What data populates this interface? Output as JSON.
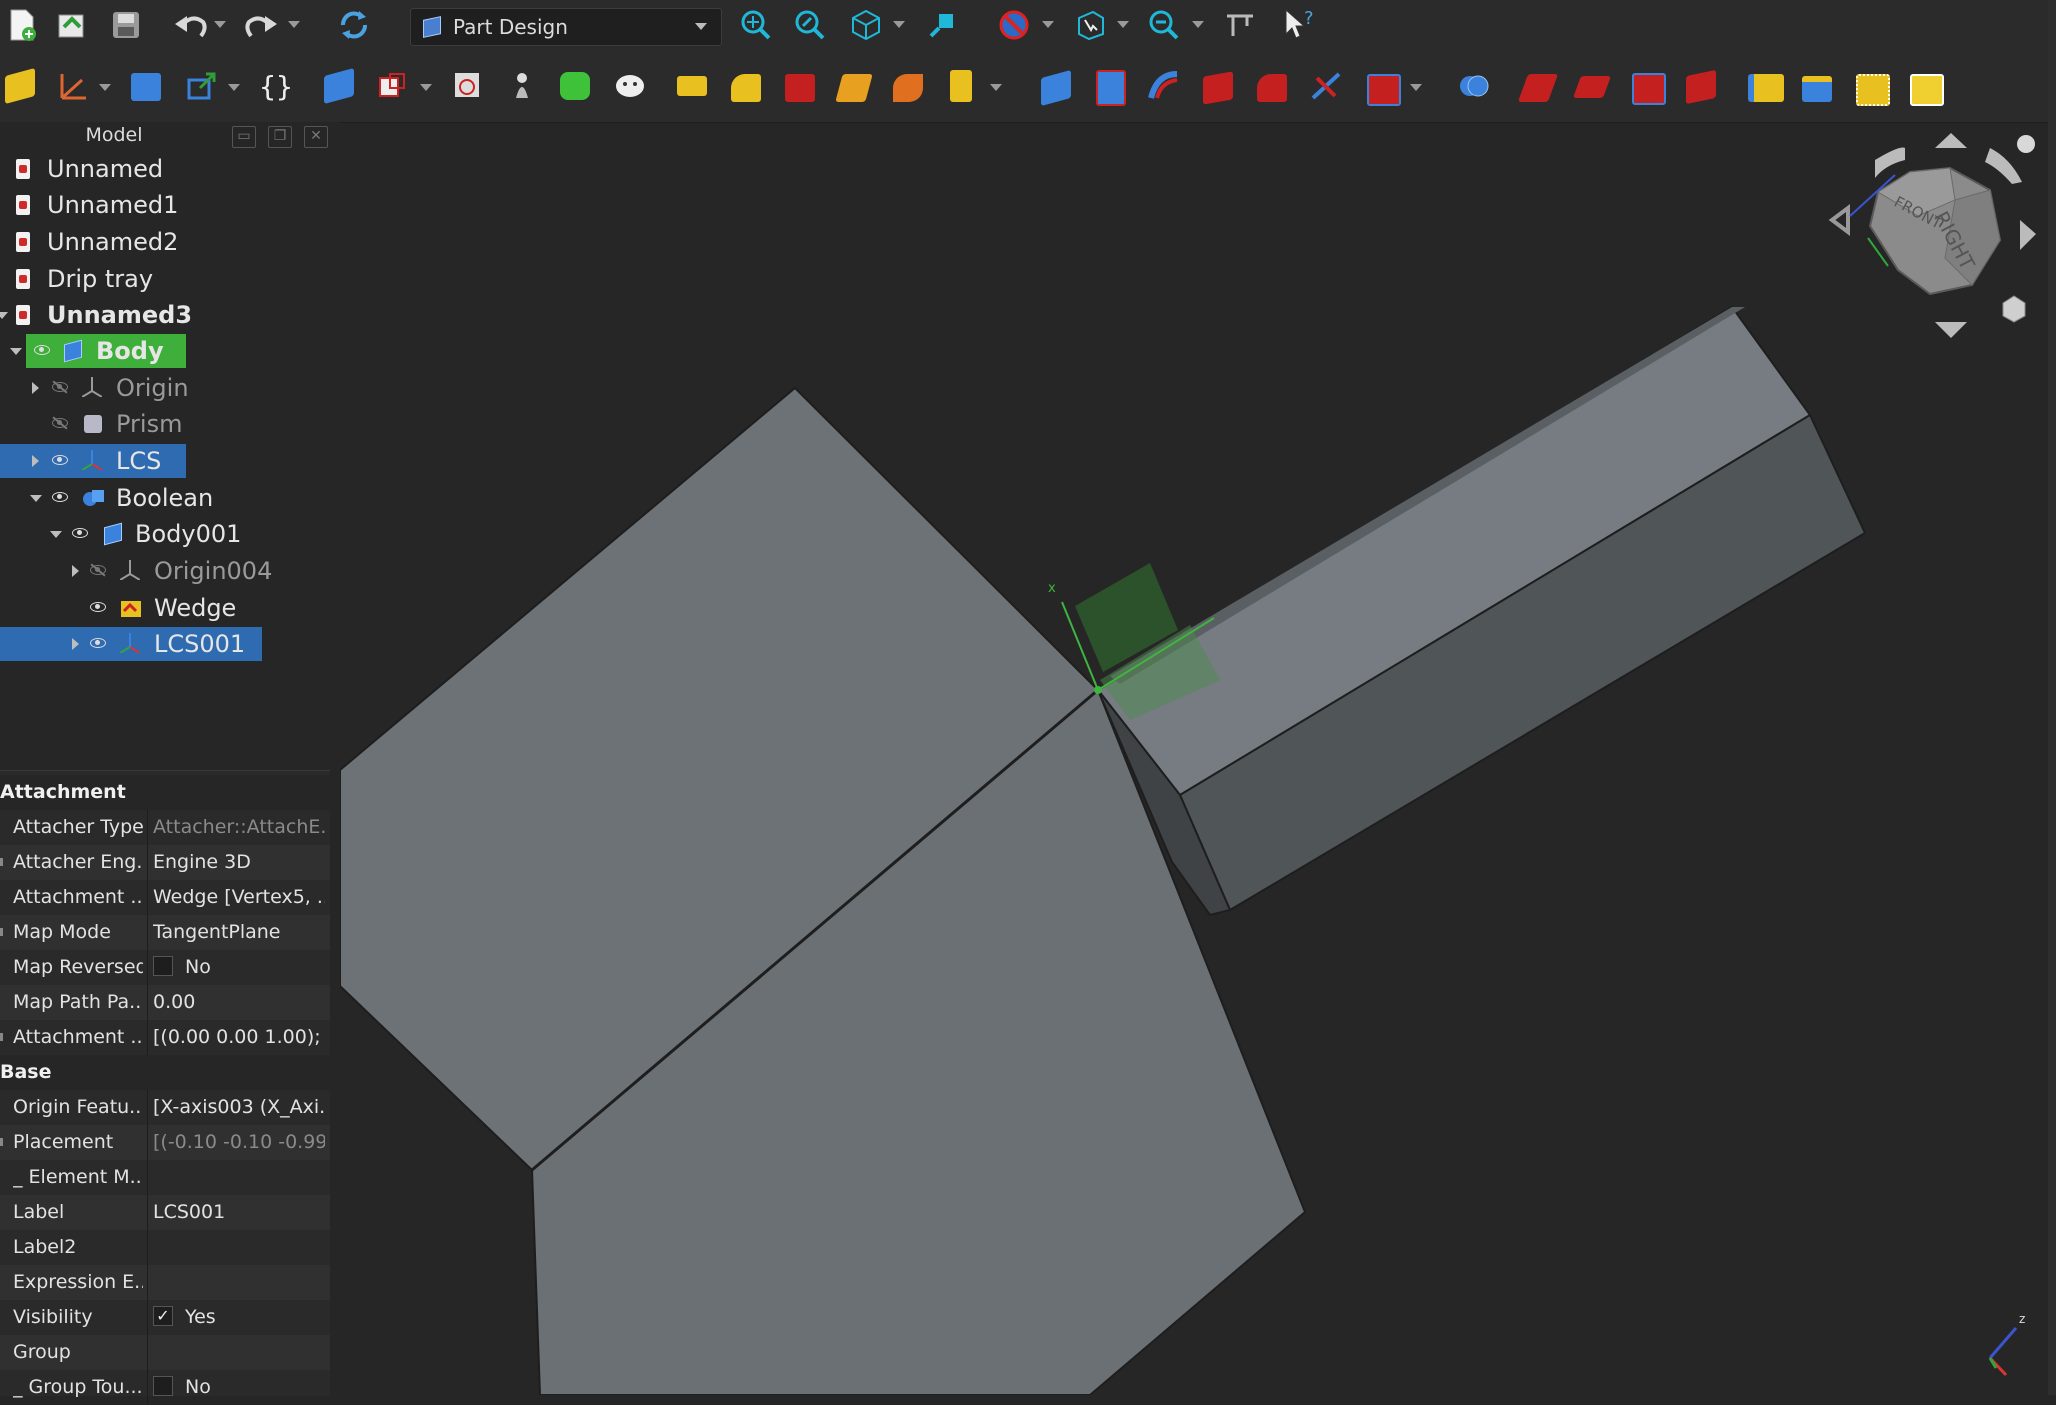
{
  "toolbar1": {
    "workbench": "Part Design",
    "icons": [
      "new-document-icon",
      "open-document-icon",
      "save-icon",
      "undo-icon",
      "redo-icon",
      "refresh-icon",
      "fit-all-icon",
      "fit-selection-icon",
      "isometric-view-icon",
      "measure-icon",
      "draw-style-icon",
      "bounding-box-icon",
      "zoom-icon",
      "measure-tool-icon",
      "whats-this-icon"
    ]
  },
  "toolbar2": {
    "icons": [
      "create-body-icon",
      "datum-axis-icon",
      "create-group-icon",
      "link-icon",
      "expression-icon",
      "create-part-icon",
      "clone-icon",
      "sketch-icon",
      "validate-sketch-icon",
      "shape-binder-icon",
      "sub-shape-binder-icon",
      "pad-icon",
      "pocket-icon",
      "revolution-icon",
      "groove-icon",
      "loft-icon",
      "pipe-icon",
      "helix-icon",
      "additive-primitive-icon",
      "subtractive-primitive-icon",
      "boolean-icon",
      "fillet-icon",
      "chamfer-icon",
      "draft-icon",
      "thickness-icon",
      "mirror-icon",
      "linear-pattern-icon",
      "polar-pattern-icon",
      "multitransform-icon"
    ]
  },
  "tree": {
    "title": "Model",
    "items": [
      {
        "label": "Unnamed"
      },
      {
        "label": "Unnamed1"
      },
      {
        "label": "Unnamed2"
      },
      {
        "label": "Drip tray"
      },
      {
        "label": "Unnamed3"
      },
      {
        "label": "Body"
      },
      {
        "label": "Origin"
      },
      {
        "label": "Prism"
      },
      {
        "label": "LCS"
      },
      {
        "label": "Boolean"
      },
      {
        "label": "Body001"
      },
      {
        "label": "Origin004"
      },
      {
        "label": "Wedge"
      },
      {
        "label": "LCS001"
      }
    ]
  },
  "properties": {
    "groups": [
      {
        "name": "Attachment",
        "rows": [
          {
            "name": "Attacher Type",
            "value": "Attacher::AttachE..."
          },
          {
            "name": "Attacher Eng...",
            "value": "Engine 3D"
          },
          {
            "name": "Attachment ...",
            "value": "Wedge [Vertex5, ..."
          },
          {
            "name": "Map Mode",
            "value": "TangentPlane"
          },
          {
            "name": "Map Reversed",
            "value": "No"
          },
          {
            "name": "Map Path Pa...",
            "value": "0.00"
          },
          {
            "name": "Attachment ...",
            "value": "[(0.00 0.00 1.00); ..."
          }
        ]
      },
      {
        "name": "Base",
        "rows": [
          {
            "name": "Origin Featu...",
            "value": "[X-axis003 (X_Axi..."
          },
          {
            "name": "Placement",
            "value": "[(-0.10 -0.10 -0.99..."
          },
          {
            "name": "_ Element M...",
            "value": ""
          },
          {
            "name": "Label",
            "value": "LCS001"
          },
          {
            "name": "Label2",
            "value": ""
          },
          {
            "name": "Expression E...",
            "value": ""
          },
          {
            "name": "Visibility",
            "value": "Yes"
          },
          {
            "name": "Group",
            "value": ""
          },
          {
            "name": "_ Group Tou...",
            "value": "No"
          }
        ]
      }
    ]
  },
  "viewport": {
    "navcube": {
      "front": "FRONT",
      "right": "RIGHT"
    },
    "axis_labels": {
      "x": "x",
      "z": "z"
    }
  }
}
